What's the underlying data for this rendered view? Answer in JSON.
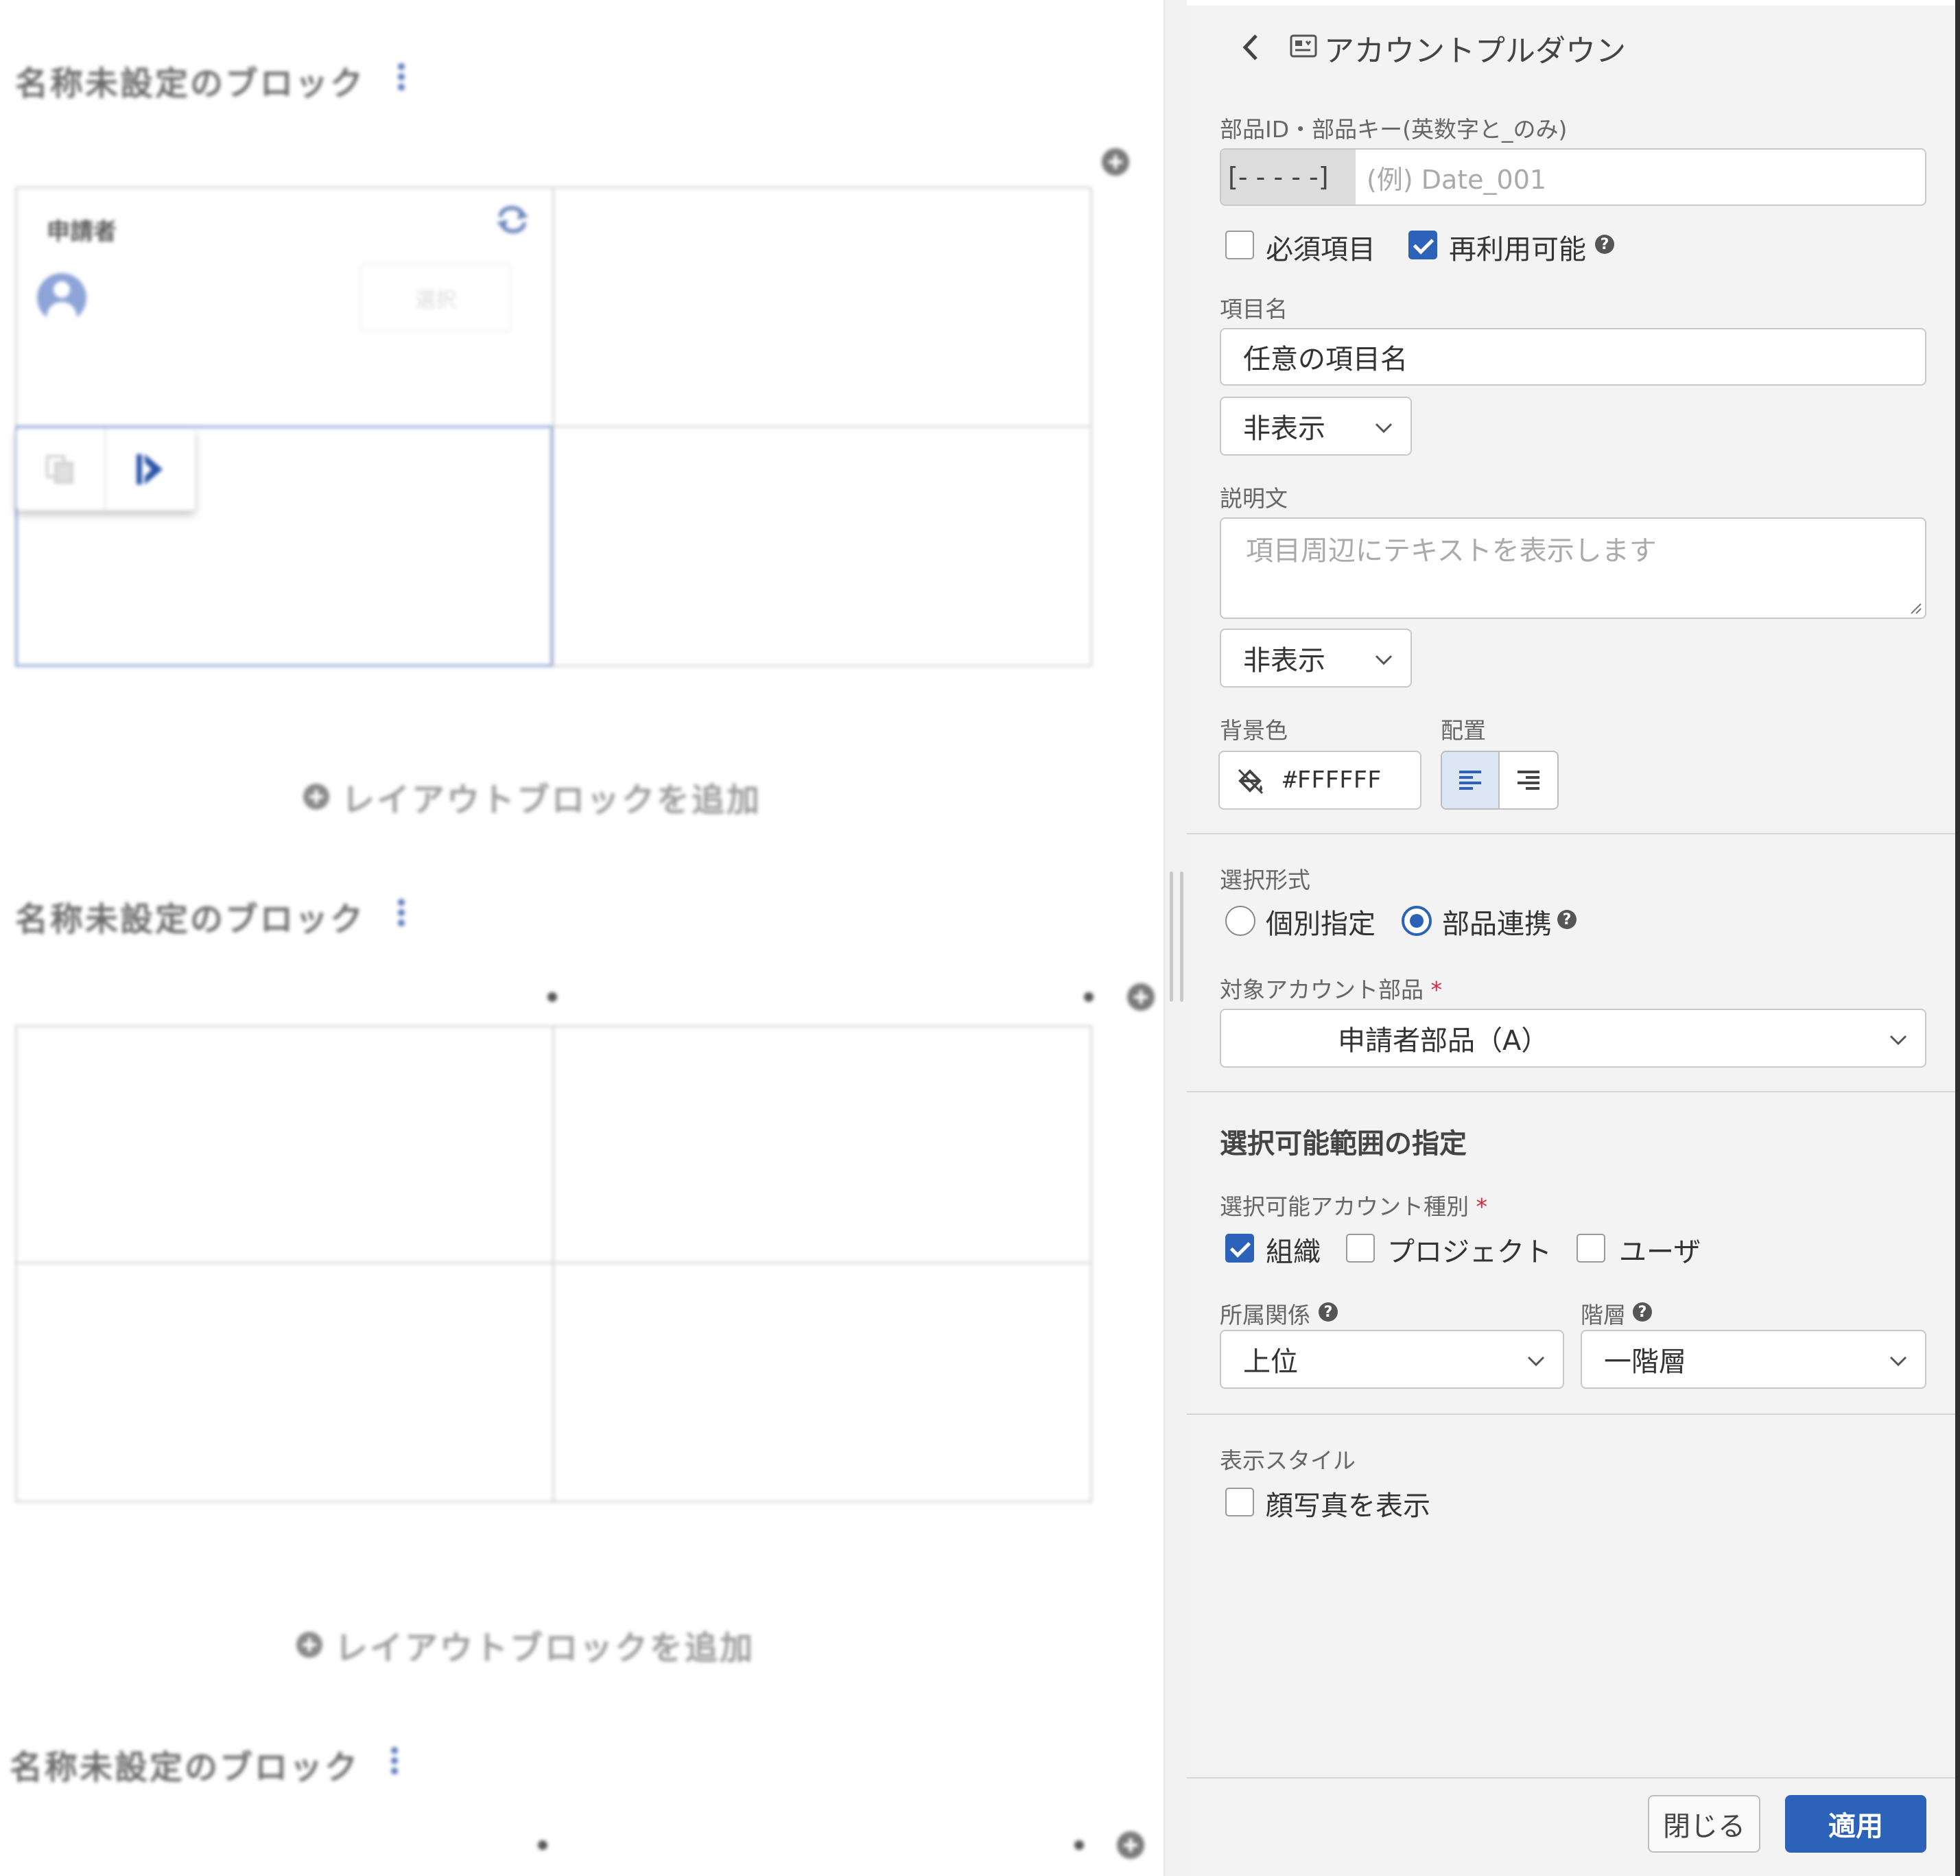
{
  "canvas": {
    "block_title": "名称未設定のブロック",
    "add_layout_label": "レイアウトブロックを追加",
    "cell_applicant_label": "申請者",
    "select_button_label": "選択"
  },
  "panel": {
    "header": {
      "title": "アカウントプルダウン"
    },
    "part_id": {
      "label": "部品ID・部品キー(英数字と_のみ)",
      "prefix": "[- - - - -]",
      "placeholder": "(例)  Date_001"
    },
    "checkboxes": {
      "required_label": "必須項目",
      "required_checked": false,
      "reusable_label": "再利用可能",
      "reusable_checked": true
    },
    "item_name": {
      "label": "項目名",
      "value": "任意の項目名",
      "visibility": "非表示"
    },
    "description": {
      "label": "説明文",
      "placeholder": "項目周辺にテキストを表示します",
      "visibility": "非表示"
    },
    "background": {
      "label": "背景色",
      "value": "#FFFFFF"
    },
    "alignment": {
      "label": "配置",
      "selected": "left"
    },
    "selection_format": {
      "label": "選択形式",
      "options": [
        "個別指定",
        "部品連携"
      ],
      "selected": "部品連携"
    },
    "target_account": {
      "label": "対象アカウント部品",
      "required_mark": "*",
      "value": "申請者部品（A）"
    },
    "range_section": {
      "title": "選択可能範囲の指定",
      "types_label": "選択可能アカウント種別",
      "required_mark": "*",
      "types": [
        {
          "label": "組織",
          "checked": true
        },
        {
          "label": "プロジェクト",
          "checked": false
        },
        {
          "label": "ユーザ",
          "checked": false
        }
      ],
      "affiliation_label": "所属関係",
      "affiliation_value": "上位",
      "hierarchy_label": "階層",
      "hierarchy_value": "一階層"
    },
    "display_style": {
      "label": "表示スタイル",
      "show_photo_label": "顔写真を表示",
      "show_photo_checked": false
    },
    "footer": {
      "close_label": "閉じる",
      "apply_label": "適用"
    },
    "help_glyph": "?"
  },
  "colors": {
    "accent": "#2c63b8",
    "required": "#d8263d",
    "panel_bg": "#f3f3f3"
  }
}
